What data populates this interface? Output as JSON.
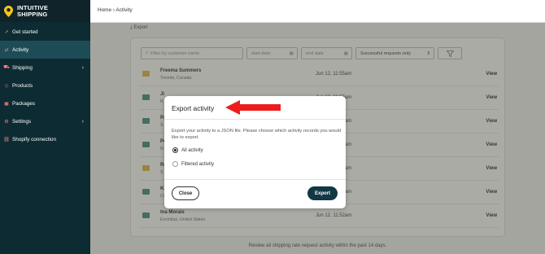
{
  "app": {
    "logo_line1": "INTUITIVE",
    "logo_line2": "SHIPPING"
  },
  "colors": {
    "sidebar": "#0d2b33",
    "sidebar_active": "#1d4c57",
    "accent_icon": "#ff7f7f",
    "export_button": "#123745",
    "arrow": "#ee1c1c"
  },
  "sidebar": {
    "items": [
      {
        "label": "Get started",
        "icon": "rocket-icon",
        "glyph": "➚"
      },
      {
        "label": "Activity",
        "icon": "activity-icon",
        "glyph": "⇄"
      },
      {
        "label": "Shipping",
        "icon": "truck-icon",
        "glyph": "⛟"
      },
      {
        "label": "Products",
        "icon": "tag-icon",
        "glyph": "◇"
      },
      {
        "label": "Packages",
        "icon": "package-icon",
        "glyph": "▣"
      },
      {
        "label": "Settings",
        "icon": "gear-icon",
        "glyph": "⚙"
      },
      {
        "label": "Shopify connection",
        "icon": "link-icon",
        "glyph": "⛓"
      }
    ]
  },
  "breadcrumb": {
    "home": "Home",
    "separator": "›",
    "current": "Activity"
  },
  "export_link": "⤓ Export",
  "filters": {
    "customer_placeholder": "Filter by customer name",
    "start_date": "start date",
    "end_date": "end date",
    "request_type": "Successful requests only"
  },
  "rows": [
    {
      "name": "Freema Summers",
      "location": "Toronto, Canada",
      "date": "Jun 12, 11:55am",
      "action": "View"
    },
    {
      "name": "Ji",
      "location": "R",
      "date": "Jun 12, 11:55am",
      "action": "View"
    },
    {
      "name": "Pa",
      "location": "S",
      "date": "Jun 12, 11:55am",
      "action": "View"
    },
    {
      "name": "Pe",
      "location": "N",
      "date": "Jun 12, 11:55am",
      "action": "View"
    },
    {
      "name": "Ro",
      "location": "S",
      "date": "Jun 12, 11:55am",
      "action": "View"
    },
    {
      "name": "Ka",
      "location": "Co",
      "date": "Jun 12, 11:55am",
      "action": "View"
    },
    {
      "name": "Ina Morais",
      "location": "Encinitas, United States",
      "date": "Jun 12, 11:52am",
      "action": "View"
    }
  ],
  "footer_text": "Review all shipping rate request activity within the past 14 days.",
  "modal": {
    "title": "Export activity",
    "description": "Export your activity to a JSON file. Please choose which activity records you would like to export.",
    "options": [
      {
        "label": "All activity",
        "checked": true
      },
      {
        "label": "Filtered activity",
        "checked": false
      }
    ],
    "close_label": "Close",
    "export_label": "Export"
  }
}
